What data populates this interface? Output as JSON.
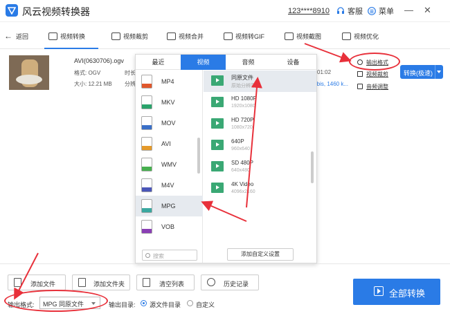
{
  "app": {
    "title": "风云视频转换器",
    "account": "123****8910",
    "service": "客服",
    "menu": "菜单"
  },
  "nav": {
    "back": "返回",
    "items": [
      {
        "label": "视频转换",
        "icon": "convert-icon"
      },
      {
        "label": "视频裁剪",
        "icon": "crop-icon"
      },
      {
        "label": "视频合并",
        "icon": "merge-icon"
      },
      {
        "label": "视频转GIF",
        "icon": "gif-icon"
      },
      {
        "label": "视频截图",
        "icon": "screenshot-icon"
      },
      {
        "label": "视频优化",
        "icon": "optimize-icon"
      }
    ]
  },
  "file": {
    "name": "AVI(0630706).ogv",
    "format": "格式: OGV",
    "size": "大小: 12.21 MB",
    "duration_label": "时长",
    "resolution_label": "分辨",
    "duration_value": "01:02",
    "info_right": "rbis, 1460 k..."
  },
  "right_actions": {
    "output_format": "输出格式",
    "video_crop": "视频裁剪",
    "audio_adjust": "音频调整",
    "convert": "转换(极速)"
  },
  "popup": {
    "tabs": [
      "最近",
      "视频",
      "音频",
      "设备"
    ],
    "formats": [
      {
        "label": "MP4",
        "color": "#e0572c"
      },
      {
        "label": "MKV",
        "color": "#2aa36b"
      },
      {
        "label": "MOV",
        "color": "#3a6fc7"
      },
      {
        "label": "AVI",
        "color": "#e59a2a"
      },
      {
        "label": "WMV",
        "color": "#47b04f"
      },
      {
        "label": "M4V",
        "color": "#4a56b8"
      },
      {
        "label": "MPG",
        "color": "#3aa8a0"
      },
      {
        "label": "VOB",
        "color": "#8a3fb5"
      }
    ],
    "resolutions": [
      {
        "name": "同原文件",
        "desc": "原始分辨率"
      },
      {
        "name": "HD 1080P",
        "desc": "1920x1080"
      },
      {
        "name": "HD 720P",
        "desc": "1080x720"
      },
      {
        "name": "640P",
        "desc": "960x640"
      },
      {
        "name": "SD 480P",
        "desc": "640x480"
      },
      {
        "name": "4K Video",
        "desc": "4096x2160"
      }
    ],
    "search_placeholder": "搜索",
    "add_custom": "添加自定义设置"
  },
  "bottom": {
    "add_file": "添加文件",
    "add_folder": "添加文件夹",
    "clear_list": "清空列表",
    "history": "历史记录",
    "output_format_label": "输出格式:",
    "output_format_value": "MPG 同原文件",
    "output_dir_label": "输出目录:",
    "source_dir": "源文件目录",
    "custom": "自定义",
    "convert_all": "全部转换"
  },
  "colors": {
    "accent": "#2a7be6",
    "annotation": "#e8303a"
  }
}
